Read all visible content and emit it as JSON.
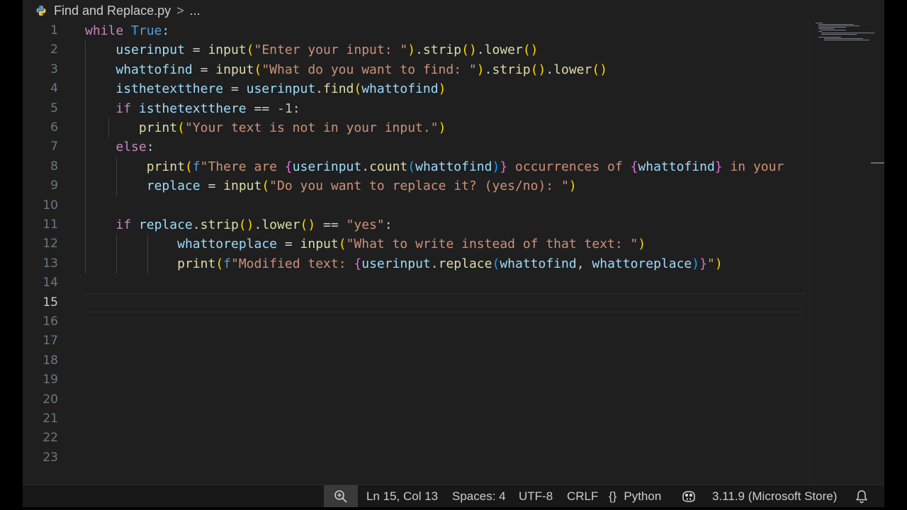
{
  "breadcrumb": {
    "file": "Find and Replace.py",
    "chevron": ">",
    "more": "..."
  },
  "editor": {
    "line_numbers": [
      "1",
      "2",
      "3",
      "4",
      "5",
      "6",
      "7",
      "8",
      "9",
      "10",
      "11",
      "12",
      "13",
      "14",
      "15",
      "16",
      "17",
      "18",
      "19",
      "20",
      "21",
      "22",
      "23"
    ],
    "current_line": 15,
    "lines": [
      "while True:",
      "    userinput = input(\"Enter your input: \").strip().lower()",
      "    whattofind = input(\"What do you want to find: \").strip().lower()",
      "    isthetextthere = userinput.find(whattofind)",
      "    if isthetextthere == -1:",
      "       print(\"Your text is not in your input.\")",
      "    else:",
      "        print(f\"There are {userinput.count(whattofind)} occurrences of {whattofind} in your",
      "        replace = input(\"Do you want to replace it? (yes/no): \")",
      "",
      "    if replace.strip().lower() == \"yes\":",
      "            whattoreplace = input(\"What to write instead of that text: \")",
      "            print(f\"Modified text: {userinput.replace(whattofind, whattoreplace)}\")",
      "",
      "",
      "",
      "",
      "",
      "",
      "",
      "",
      "",
      ""
    ]
  },
  "statusbar": {
    "zoom_icon": "zoom-in-icon",
    "position": "Ln 15, Col 13",
    "spaces": "Spaces: 4",
    "encoding": "UTF-8",
    "eol": "CRLF",
    "language_icon": "{}",
    "language": "Python",
    "copilot_icon": "copilot-icon",
    "interpreter": "3.11.9 (Microsoft Store)",
    "bell_icon": "bell-icon"
  },
  "colors": {
    "background": "#1f1f1f",
    "keyword": "#c586c0",
    "constant": "#569cd6",
    "variable": "#9cdcfe",
    "function": "#dcdcaa",
    "string": "#ce9178",
    "number": "#b5cea8",
    "bracket_1": "#ffd700",
    "bracket_2": "#da70d6",
    "bracket_3": "#179fff"
  }
}
